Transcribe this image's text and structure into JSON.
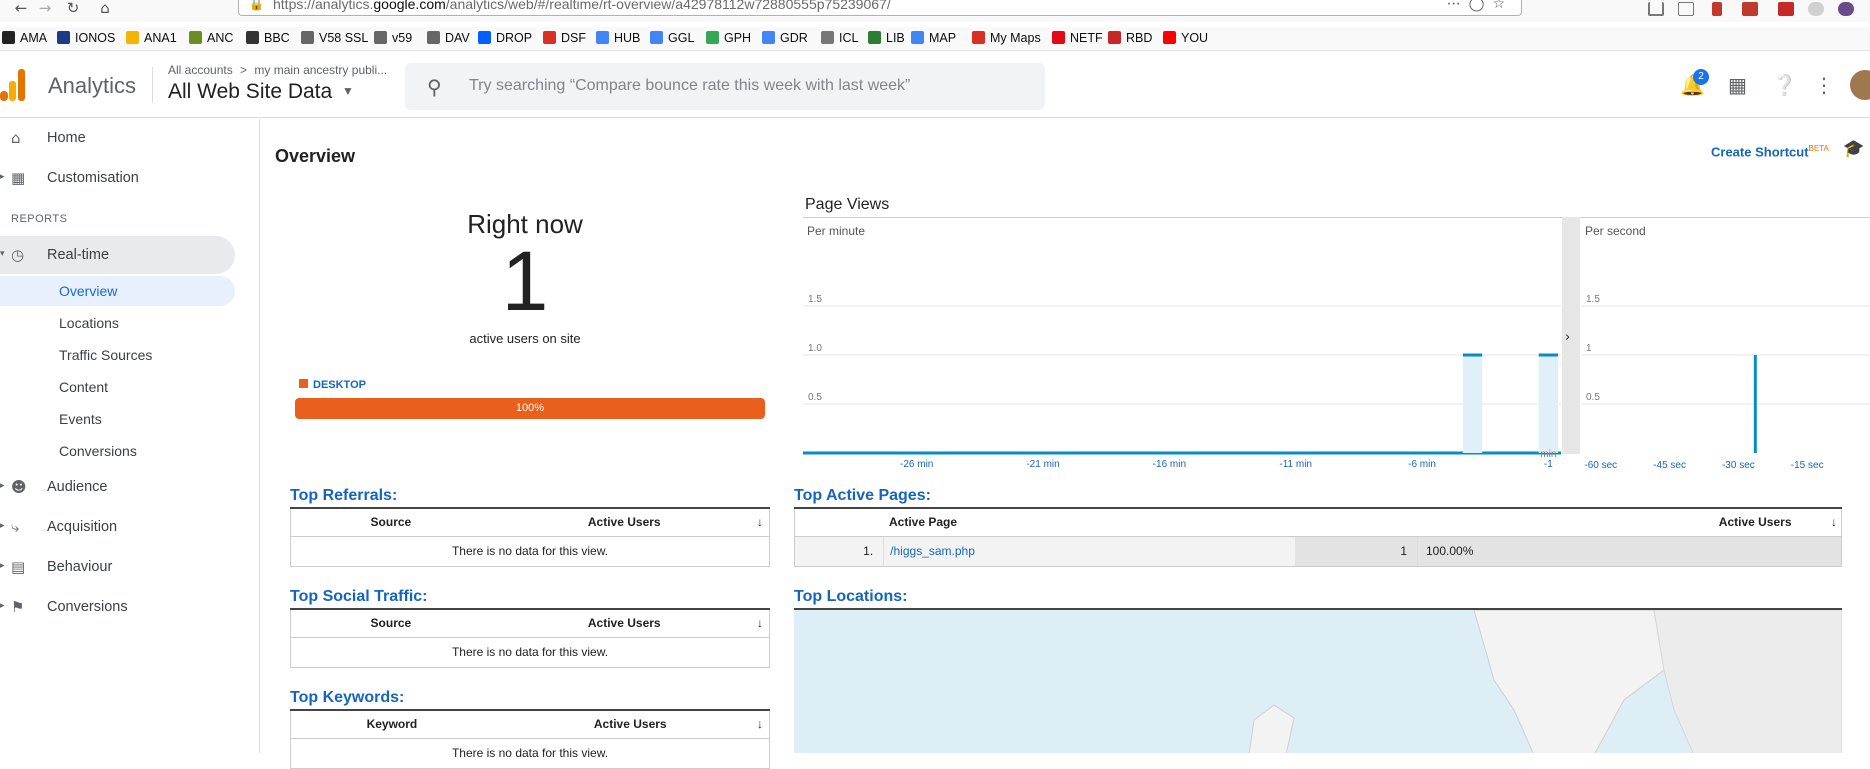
{
  "browser": {
    "url_prefix": "https://analytics.",
    "url_domain": "google.com",
    "url_suffix": "/analytics/web/#/realtime/rt-overview/a42978112w72880555p75239067/",
    "bookmarks": [
      {
        "label": "AMA",
        "color": "#222222"
      },
      {
        "label": "IONOS",
        "color": "#1a3a8a"
      },
      {
        "label": "ANA1",
        "color": "#f4b400"
      },
      {
        "label": "ANC",
        "color": "#6b8e23"
      },
      {
        "label": "BBC",
        "color": "#333333"
      },
      {
        "label": "V58 SSL",
        "color": "#666666"
      },
      {
        "label": "v59",
        "color": "#666666"
      },
      {
        "label": "DAV",
        "color": "#666666"
      },
      {
        "label": "DROP",
        "color": "#0061fe"
      },
      {
        "label": "DSF",
        "color": "#d93025"
      },
      {
        "label": "HUB",
        "color": "#4285f4"
      },
      {
        "label": "GGL",
        "color": "#4285f4"
      },
      {
        "label": "GPH",
        "color": "#34a853"
      },
      {
        "label": "GDR",
        "color": "#4285f4"
      },
      {
        "label": "ICL",
        "color": "#777777"
      },
      {
        "label": "LIB",
        "color": "#2e7d32"
      },
      {
        "label": "MAP",
        "color": "#4285f4"
      },
      {
        "label": "My Maps",
        "color": "#d93025"
      },
      {
        "label": "NETF",
        "color": "#e50914"
      },
      {
        "label": "RBD",
        "color": "#c62828"
      },
      {
        "label": "YOU",
        "color": "#ff0000"
      }
    ]
  },
  "header": {
    "app_name": "Analytics",
    "breadcrumb_root": "All accounts",
    "breadcrumb_sep": ">",
    "breadcrumb_property": "my main ancestry publi...",
    "view_name": "All Web Site Data",
    "search_placeholder": "Try searching “Compare bounce rate this week with last week”",
    "notification_count": "2"
  },
  "sidebar": {
    "home": "Home",
    "customisation": "Customisation",
    "reports_heading": "REPORTS",
    "realtime": "Real-time",
    "realtime_sub": [
      "Overview",
      "Locations",
      "Traffic Sources",
      "Content",
      "Events",
      "Conversions"
    ],
    "audience": "Audience",
    "acquisition": "Acquisition",
    "behaviour": "Behaviour",
    "conversions": "Conversions"
  },
  "main": {
    "title": "Overview",
    "create_shortcut": "Create Shortcut",
    "beta": "BETA",
    "right_now": {
      "title": "Right now",
      "active_users": "1",
      "subtitle": "active users on site",
      "device_label": "DESKTOP",
      "device_share_label": "100%",
      "device_share": 1.0
    },
    "page_views": {
      "title": "Page Views",
      "per_minute_label": "Per minute",
      "per_second_label": "Per second"
    },
    "top_referrals": {
      "title": "Top Referrals:",
      "col1": "Source",
      "col2": "Active Users",
      "empty": "There is no data for this view."
    },
    "top_social": {
      "title": "Top Social Traffic:",
      "col1": "Source",
      "col2": "Active Users",
      "empty": "There is no data for this view."
    },
    "top_keywords": {
      "title": "Top Keywords:",
      "col1": "Keyword",
      "col2": "Active Users",
      "empty": "There is no data for this view."
    },
    "top_active_pages": {
      "title": "Top Active Pages:",
      "col1": "Active Page",
      "col2": "Active Users",
      "rows": [
        {
          "rank": "1.",
          "page": "/higgs_sam.php",
          "users": "1",
          "pct": "100.00%"
        }
      ]
    },
    "top_locations": {
      "title": "Top Locations:"
    }
  },
  "chart_data": [
    {
      "type": "bar",
      "title": "Page Views",
      "subtitle": "Per minute",
      "x_tick_labels": [
        "-26 min",
        "-21 min",
        "-16 min",
        "-11 min",
        "-6 min",
        "-1"
      ],
      "x_extra_label": "min",
      "y_tick_labels": [
        "0.5",
        "1.0",
        "1.5"
      ],
      "ylim": [
        0,
        2
      ],
      "x": [
        -30,
        -29,
        -28,
        -27,
        -26,
        -25,
        -24,
        -23,
        -22,
        -21,
        -20,
        -19,
        -18,
        -17,
        -16,
        -15,
        -14,
        -13,
        -12,
        -11,
        -10,
        -9,
        -8,
        -7,
        -6,
        -5,
        -4,
        -3,
        -2,
        -1
      ],
      "values": [
        0,
        0,
        0,
        0,
        0,
        0,
        0,
        0,
        0,
        0,
        0,
        0,
        0,
        0,
        0,
        0,
        0,
        0,
        0,
        0,
        0,
        0,
        0,
        0,
        0,
        0,
        1,
        0,
        0,
        1
      ],
      "color": "#058dc7"
    },
    {
      "type": "bar",
      "subtitle": "Per second",
      "x_tick_labels": [
        "-60 sec",
        "-45 sec",
        "-30 sec",
        "-15 sec"
      ],
      "y_tick_labels": [
        "0.5",
        "1",
        "1.5"
      ],
      "ylim": [
        0,
        2
      ],
      "x": [
        -60,
        -55,
        -50,
        -45,
        -40,
        -35,
        -30,
        -25,
        -20,
        -15,
        -10,
        -5
      ],
      "values": [
        0,
        0,
        0,
        0,
        0,
        0,
        0,
        1,
        0,
        0,
        0,
        0
      ],
      "color": "#058dc7"
    }
  ]
}
